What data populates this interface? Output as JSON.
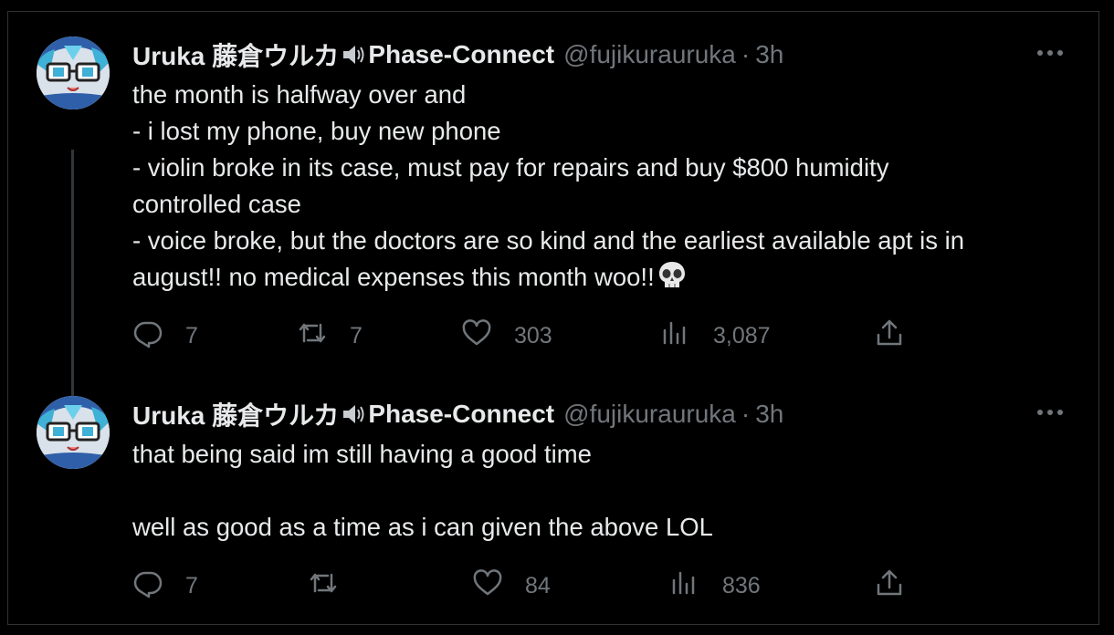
{
  "tweets": [
    {
      "display_name": "Uruka 藤倉ウルカ",
      "name_suffix": "Phase-Connect",
      "handle": "@fujikurauruka",
      "separator": "·",
      "time": "3h",
      "lines": [
        "the month is halfway over and",
        "- i lost my phone, buy new phone",
        "- violin broke in its case, must pay for repairs and buy $800 humidity",
        "controlled case",
        "- voice broke, but the doctors are so kind and the earliest available apt is in",
        "august!! no medical expenses this month woo!!"
      ],
      "emoji": "skull",
      "replies": "7",
      "retweets": "7",
      "likes": "303",
      "views": "3,087"
    },
    {
      "display_name": "Uruka 藤倉ウルカ",
      "name_suffix": "Phase-Connect",
      "handle": "@fujikurauruka",
      "separator": "·",
      "time": "3h",
      "lines": [
        "that being said im still having a good time",
        "",
        "well as good as a time as i can given the above LOL"
      ],
      "replies": "7",
      "retweets": "",
      "likes": "84",
      "views": "836"
    }
  ],
  "icons": {
    "more": "more-horizontal-icon",
    "reply": "reply-icon",
    "retweet": "retweet-icon",
    "like": "heart-icon",
    "views": "views-icon",
    "share": "share-icon",
    "speaker": "speaker-icon"
  },
  "colors": {
    "background": "#000000",
    "text": "#e7e9ea",
    "secondary": "#71767b",
    "border": "#2f3336"
  }
}
